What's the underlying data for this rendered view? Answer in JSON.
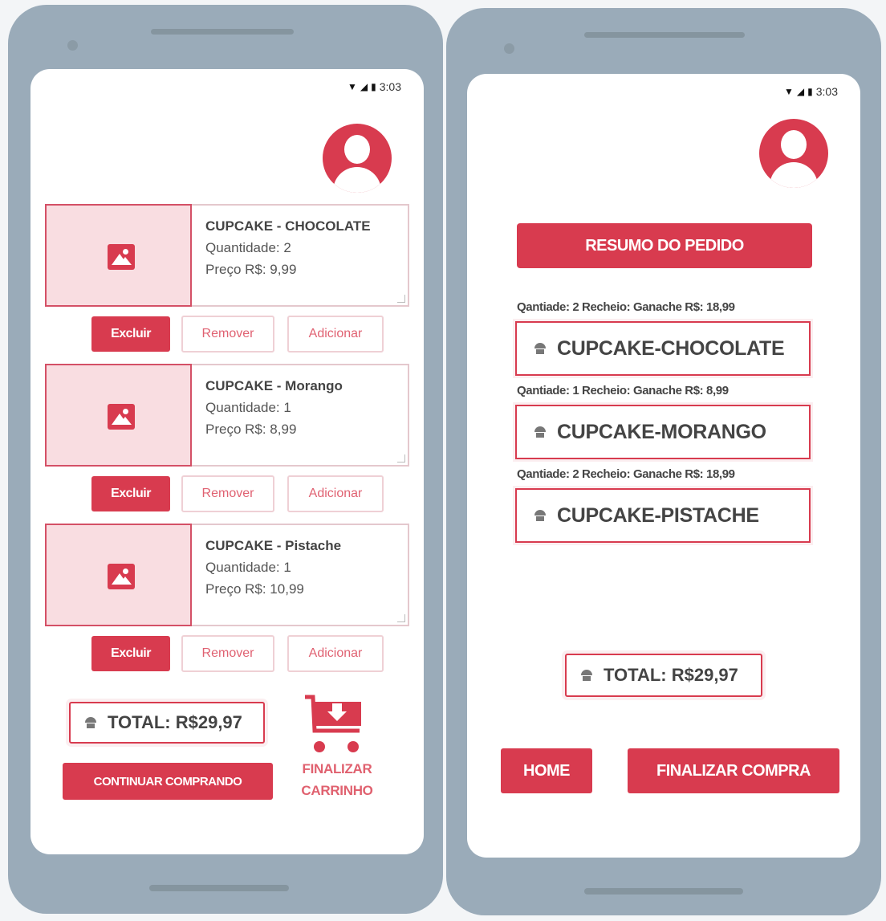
{
  "status_bar": {
    "time": "3:03"
  },
  "cart_screen": {
    "items": [
      {
        "name": "CUPCAKE - CHOCOLATE",
        "quantity": "Quantidade: 2",
        "price": "Preço R$: 9,99"
      },
      {
        "name": "CUPCAKE - Morango",
        "quantity": "Quantidade: 1",
        "price": "Preço R$: 8,99"
      },
      {
        "name": "CUPCAKE - Pistache",
        "quantity": "Quantidade: 1",
        "price": "Preço R$: 10,99"
      }
    ],
    "buttons": {
      "delete": "Excluir",
      "remove": "Remover",
      "add": "Adicionar"
    },
    "total": "TOTAL: R$29,97",
    "continue_button": "CONTINUAR COMPRANDO",
    "checkout_line1": "FINALIZAR",
    "checkout_line2": "CARRINHO"
  },
  "summary_screen": {
    "title_button": "RESUMO DO PEDIDO",
    "entries": [
      {
        "detail": "Qantiade: 2 Recheio: Ganache R$: 18,99",
        "name": "CUPCAKE-CHOCOLATE"
      },
      {
        "detail": "Qantiade: 1 Recheio: Ganache R$: 8,99",
        "name": "CUPCAKE-MORANGO"
      },
      {
        "detail": "Qantiade: 2 Recheio: Ganache R$: 18,99",
        "name": "CUPCAKE-PISTACHE"
      }
    ],
    "total": "TOTAL: R$29,97",
    "home_button": "HOME",
    "finish_button": "FINALIZAR COMPRA"
  },
  "colors": {
    "accent": "#d83b4f",
    "frame": "#9aabb9",
    "image_bg": "#f9dde1"
  },
  "icons": [
    "wifi-icon",
    "signal-icon",
    "battery-icon",
    "avatar-icon",
    "image-placeholder-icon",
    "cupcake-icon",
    "cart-download-icon"
  ]
}
